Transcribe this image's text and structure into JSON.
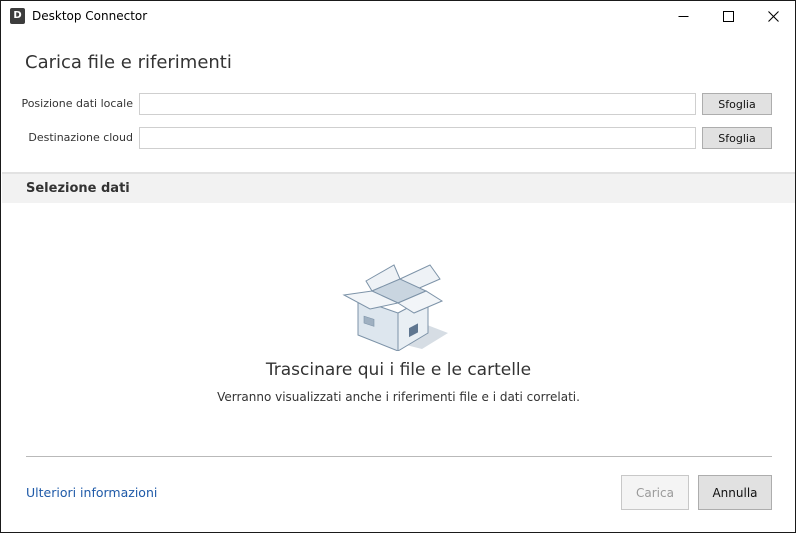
{
  "window": {
    "title": "Desktop Connector",
    "icon_letter": "D"
  },
  "form": {
    "heading": "Carica file e riferimenti",
    "local_label": "Posizione dati locale",
    "local_value": "",
    "cloud_label": "Destinazione cloud",
    "cloud_value": "",
    "browse_label": "Sfoglia"
  },
  "selection": {
    "header": "Selezione dati",
    "drop_title": "Trascinare qui i file e le cartelle",
    "drop_subtitle": "Verranno visualizzati anche i riferimenti file e i dati correlati."
  },
  "footer": {
    "more_info": "Ulteriori informazioni",
    "upload_label": "Carica",
    "cancel_label": "Annulla"
  },
  "icons": [
    "app-icon",
    "minimize-icon",
    "maximize-icon",
    "close-icon",
    "open-box-icon"
  ],
  "colors": {
    "link": "#1f5aa8",
    "section_bg": "#f2f2f2",
    "box_fill": "#dde6ee",
    "box_stroke": "#7d93a8"
  }
}
